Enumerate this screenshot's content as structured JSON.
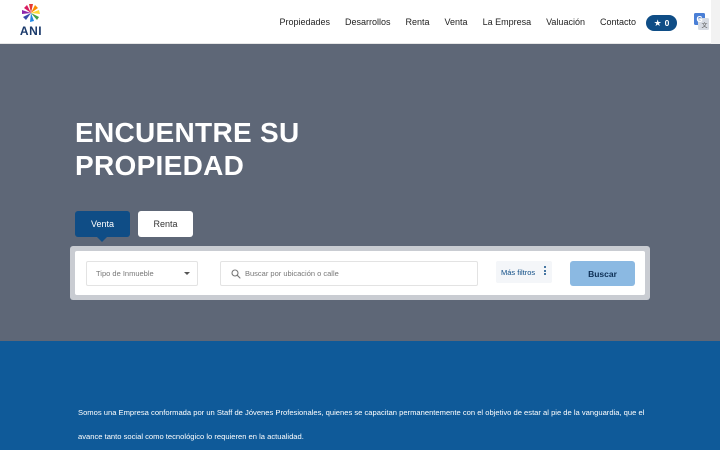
{
  "header": {
    "logo_text": "ANI",
    "nav": [
      {
        "label": "Propiedades"
      },
      {
        "label": "Desarrollos"
      },
      {
        "label": "Renta"
      },
      {
        "label": "Venta"
      },
      {
        "label": "La Empresa"
      },
      {
        "label": "Valuación"
      },
      {
        "label": "Contacto"
      }
    ],
    "favorites_count": "0"
  },
  "hero": {
    "title_line1": "ENCUENTRE SU",
    "title_line2": "PROPIEDAD",
    "tabs": [
      {
        "label": "Venta",
        "active": true
      },
      {
        "label": "Renta",
        "active": false
      }
    ],
    "search": {
      "property_type_placeholder": "Tipo de Inmueble",
      "location_placeholder": "Buscar por ubicación o calle",
      "more_filters_label": "Más filtros",
      "submit_label": "Buscar"
    }
  },
  "about": {
    "text": "Somos una Empresa conformada por un Staff de Jóvenes Profesionales, quienes se capacitan permanentemente con el objetivo de estar al pie de la vanguardia, que el avance tanto social como tecnológico lo requieren en la actualidad."
  },
  "colors": {
    "brand_blue": "#0f4d86",
    "hero_bg": "#5e6777",
    "about_bg": "#0f5a99",
    "button_light_blue": "#8bb9e2"
  },
  "icons": {
    "logo": "pinwheel-logo-icon",
    "favorites": "star-icon",
    "translate": "translate-icon",
    "search": "search-icon",
    "dropdown": "caret-down-icon",
    "more": "vertical-dots-icon"
  }
}
